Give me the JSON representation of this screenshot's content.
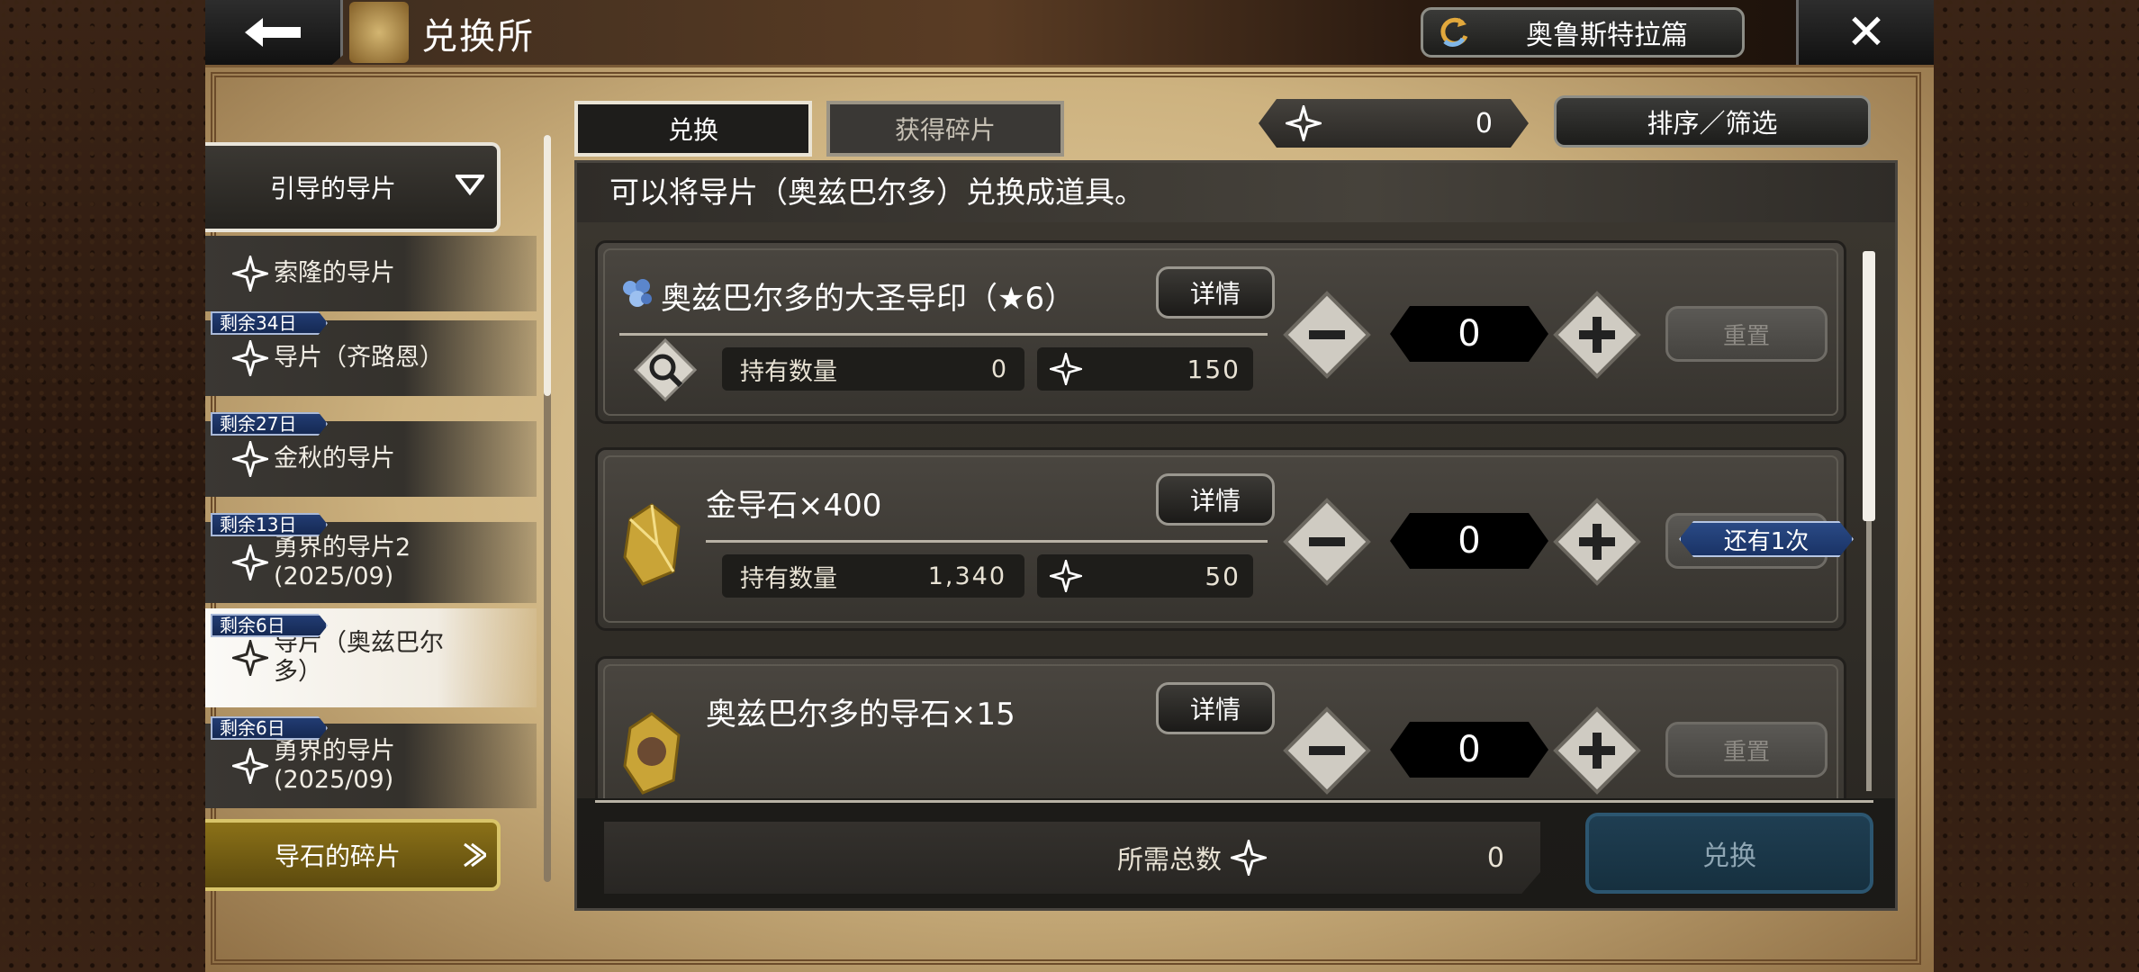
{
  "header": {
    "title": "兑换所",
    "chapter_button": "奥鲁斯特拉篇"
  },
  "sidebar": {
    "category_header": "引导的导片",
    "items": [
      {
        "badge": "",
        "label": "索隆的导片",
        "active": false
      },
      {
        "badge": "剩余34日",
        "label": "导片（齐路恩）",
        "active": false
      },
      {
        "badge": "剩余27日",
        "label": "金秋的导片",
        "active": false
      },
      {
        "badge": "剩余13日",
        "label": "勇界的导片2\n(2025/09)",
        "active": false
      },
      {
        "badge": "剩余6日",
        "label": "导片（奥兹巴尔\n多）",
        "active": true
      },
      {
        "badge": "剩余6日",
        "label": "勇界的导片\n(2025/09)",
        "active": false
      }
    ],
    "category_footer": "导石的碎片"
  },
  "tabs": {
    "exchange": "兑换",
    "get_fragments": "获得碎片"
  },
  "fragment_count": "0",
  "sort_button": "排序／筛选",
  "description": "可以将导片（奥兹巴尔多）兑换成道具。",
  "items": [
    {
      "name": "奥兹巴尔多的大圣导印（★6）",
      "detail": "详情",
      "held_label": "持有数量",
      "held": "0",
      "cost": "150",
      "qty": "0",
      "reset": "重置",
      "icon": "blue-crystal-icon"
    },
    {
      "name": "金导石×400",
      "detail": "详情",
      "held_label": "持有数量",
      "held": "1,340",
      "cost": "50",
      "qty": "0",
      "reset": "重置",
      "icon": "gold-stone-icon",
      "remaining": "还有1次"
    },
    {
      "name": "奥兹巴尔多的导石×15",
      "detail": "详情",
      "held_label": "持有数量",
      "held": "",
      "cost": "",
      "qty": "0",
      "reset": "重置",
      "icon": "portrait-stone-icon"
    }
  ],
  "total": {
    "label": "所需总数",
    "value": "0"
  },
  "exchange_button": "兑换",
  "colors": {
    "badge_blue": "#1a3366",
    "gold_button": "#8b7118",
    "exchange_button": "#1f3e52"
  }
}
